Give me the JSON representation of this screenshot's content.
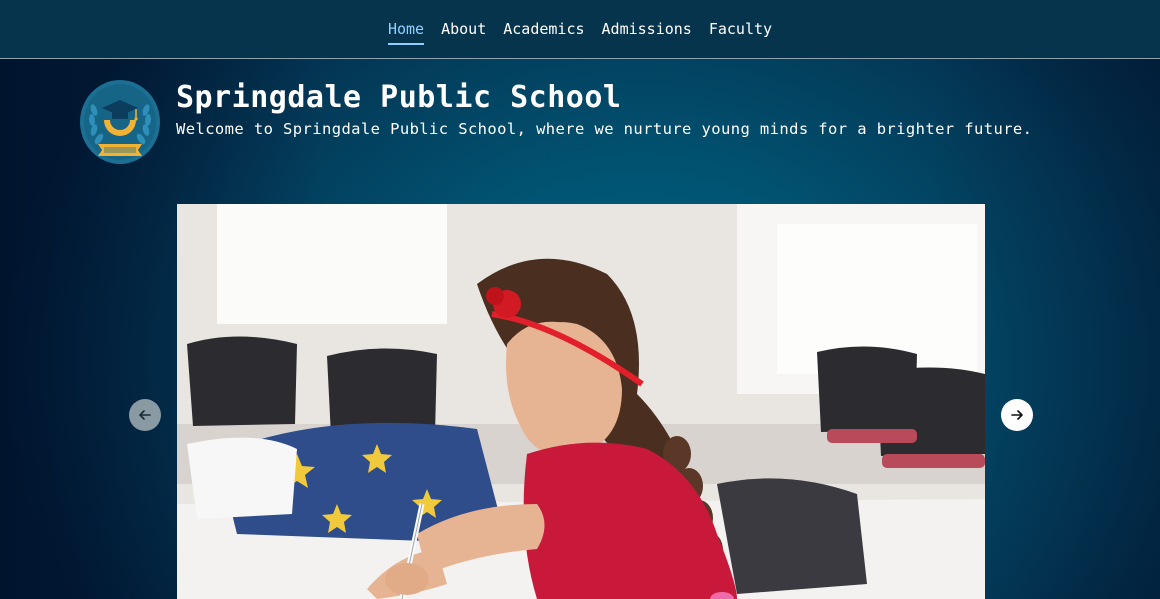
{
  "nav": {
    "items": [
      {
        "label": "Home",
        "active": true
      },
      {
        "label": "About",
        "active": false
      },
      {
        "label": "Academics",
        "active": false
      },
      {
        "label": "Admissions",
        "active": false
      },
      {
        "label": "Faculty",
        "active": false
      }
    ]
  },
  "header": {
    "title": "Springdale Public School",
    "tagline": "Welcome to Springdale Public School, where we nurture young minds for a brighter future.",
    "logo_icon": "graduation-cap-laurel-logo"
  },
  "carousel": {
    "image_alt": "Girl writing at a desk in a classroom",
    "prev_icon": "arrow-left-icon",
    "next_icon": "arrow-right-icon"
  },
  "colors": {
    "nav_bg": "#07344d",
    "active_link": "#8fd0ff",
    "background": "#015473",
    "logo_circle": "#1a6f93",
    "logo_gold": "#f2b233"
  }
}
